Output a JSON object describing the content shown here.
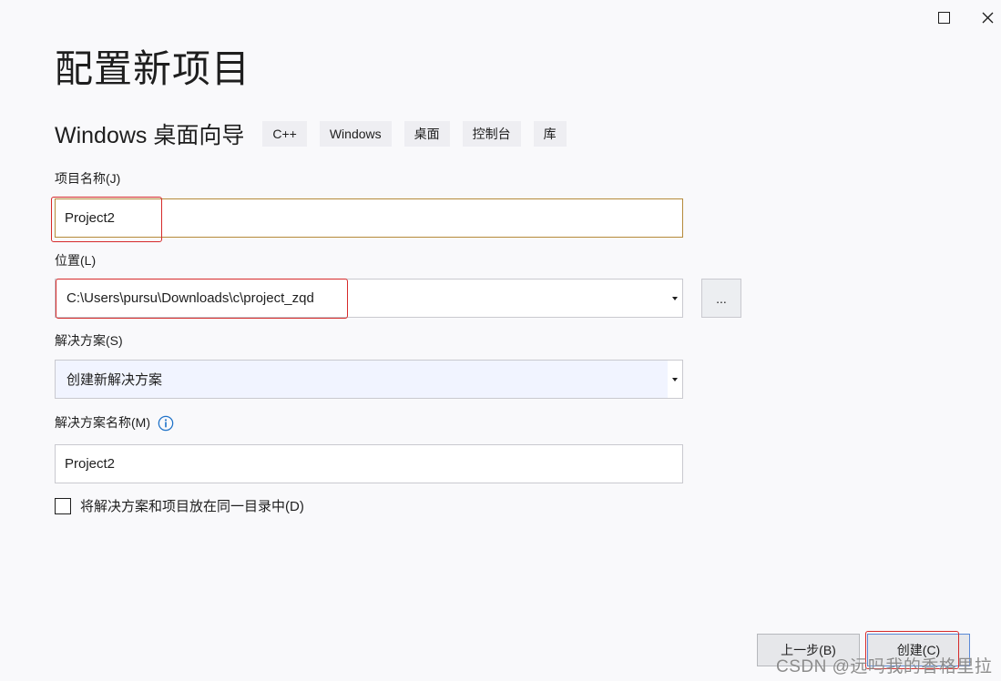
{
  "window": {
    "maximize_icon": "maximize-square-icon",
    "close_icon": "close-x-icon"
  },
  "page": {
    "title": "配置新项目"
  },
  "template": {
    "name": "Windows 桌面向导",
    "tags": [
      "C++",
      "Windows",
      "桌面",
      "控制台",
      "库"
    ]
  },
  "project_name": {
    "label": "项目名称(J)",
    "value": "Project2"
  },
  "location": {
    "label": "位置(L)",
    "value": "C:\\Users\\pursu\\Downloads\\c\\project_zqd",
    "browse_label": "..."
  },
  "solution": {
    "label": "解决方案(S)",
    "value": "创建新解决方案"
  },
  "solution_name": {
    "label": "解决方案名称(M)",
    "value": "Project2",
    "info_icon": "info-circle-icon"
  },
  "same_dir": {
    "label": "将解决方案和项目放在同一目录中(D)",
    "checked": false
  },
  "footer": {
    "back_label": "上一步(B)",
    "create_label": "创建(C)"
  },
  "watermark": {
    "text": "CSDN @远吗我的香格里拉"
  },
  "colors": {
    "highlight": "#d62a2a",
    "focus_border": "#b58a3a",
    "info_blue": "#1f72c8",
    "primary_border": "#5a89d6"
  }
}
